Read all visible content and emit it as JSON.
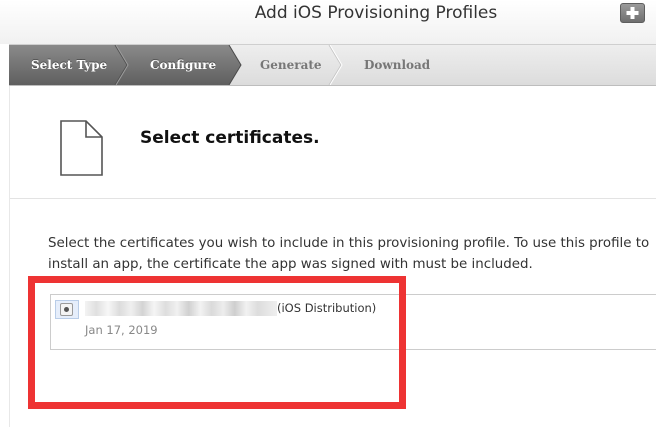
{
  "window": {
    "title": "Add iOS Provisioning Profiles",
    "add_icon": "plus-icon"
  },
  "steps": [
    {
      "label": "Select Type",
      "state": "completed"
    },
    {
      "label": "Configure",
      "state": "current"
    },
    {
      "label": "Generate",
      "state": "pending"
    },
    {
      "label": "Download",
      "state": "pending"
    }
  ],
  "section": {
    "icon": "document-icon",
    "title": "Select certificates."
  },
  "instructions": "Select the certificates you wish to include in this provisioning profile. To use this profile to install an app, the certificate the app was signed with must be included.",
  "certificates": [
    {
      "name_suffix": "(iOS Distribution)",
      "date": "Jan 17, 2019",
      "selected": true
    }
  ],
  "colors": {
    "step_active": "#6f6f6f",
    "step_inactive": "#e4e4e4",
    "annotation": "#ee3333"
  }
}
